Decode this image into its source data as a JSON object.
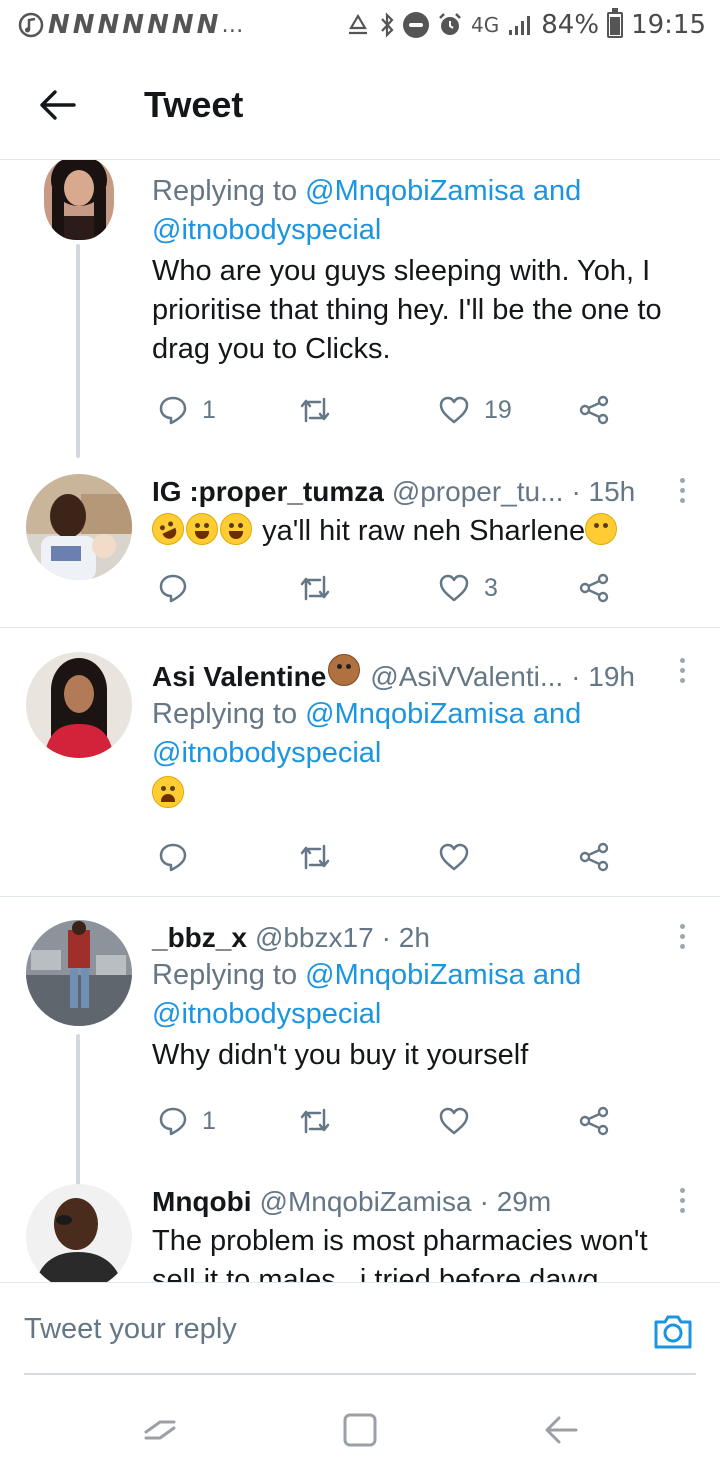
{
  "status_bar": {
    "network": "4G",
    "battery": "84%",
    "battery_level": 0.84,
    "time": "19:15",
    "notification_letters": [
      "N",
      "N",
      "N",
      "N",
      "N",
      "N",
      "N"
    ],
    "overflow": "…"
  },
  "header": {
    "title": "Tweet",
    "back_icon": "back-arrow-icon"
  },
  "tweets": [
    {
      "replying_prefix": "Replying to",
      "mentions": [
        "@MnqobiZamisa",
        "@itnobodyspecial"
      ],
      "and_word": "and",
      "text": "Who are you guys sleeping with. Yoh, I prioritise that thing hey. I'll be the one to drag you to Clicks.",
      "reply_count": "1",
      "like_count": "19"
    },
    {
      "display_name": "IG :proper_tumza",
      "handle": "@proper_tu...",
      "time": "· 15h",
      "text": "ya'll hit raw neh Sharlene",
      "like_count": "3"
    },
    {
      "display_name": "Asi Valentine",
      "handle": "@AsiVValenti...",
      "time": "· 19h",
      "replying_prefix": "Replying to",
      "mentions": [
        "@MnqobiZamisa",
        "@itnobodyspecial"
      ],
      "and_word": "and"
    },
    {
      "display_name": "_bbz_x",
      "handle": "@bbzx17",
      "time": "· 2h",
      "replying_prefix": "Replying to",
      "mentions": [
        "@MnqobiZamisa",
        "@itnobodyspecial"
      ],
      "and_word": "and",
      "text": "Why didn't you buy it yourself",
      "reply_count": "1"
    },
    {
      "display_name": "Mnqobi",
      "handle": "@MnqobiZamisa",
      "time": "· 29m",
      "text_line1": "The problem is most pharmacies won't",
      "text_line2": "sell it to males...i tried before dawg"
    }
  ],
  "reply_bar": {
    "placeholder": "Tweet your reply",
    "camera_icon": "camera-icon"
  },
  "colors": {
    "link": "#1b95e0",
    "muted": "#657786",
    "text": "#14171a",
    "divider": "#e1e8ed"
  }
}
